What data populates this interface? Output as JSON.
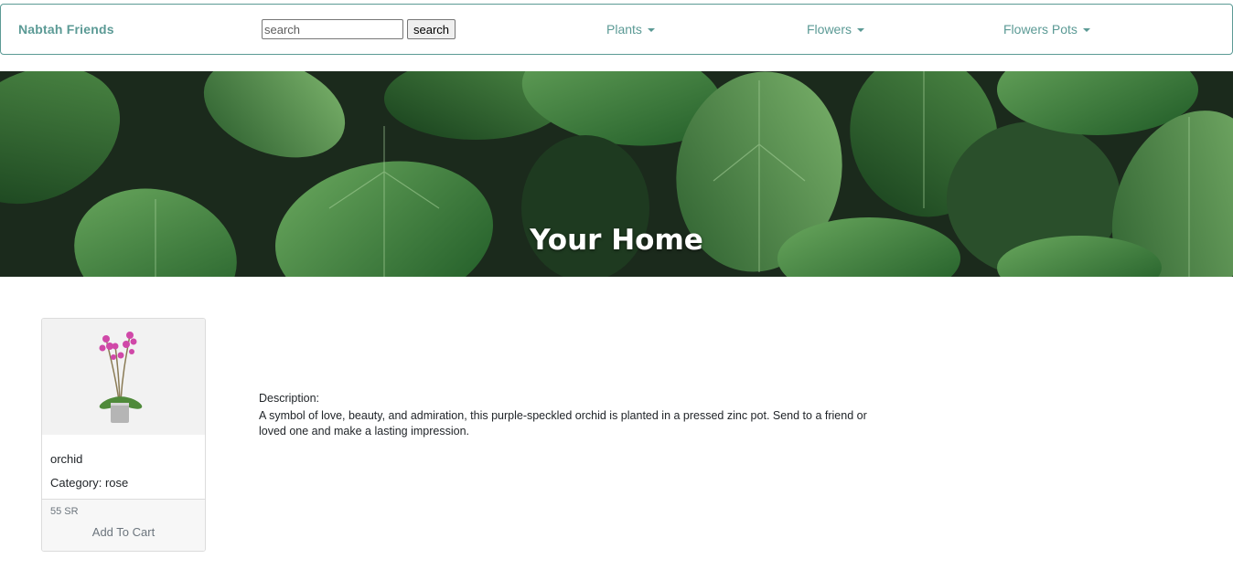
{
  "navbar": {
    "brand": "Nabtah Friends",
    "search": {
      "placeholder": "search",
      "value": "",
      "button_label": "search"
    },
    "menus": [
      {
        "label": "Plants"
      },
      {
        "label": "Flowers"
      },
      {
        "label": "Flowers Pots"
      }
    ]
  },
  "hero": {
    "title": "Your Home"
  },
  "product": {
    "name": "orchid",
    "category": "Category: rose",
    "price": "55 SR",
    "cart_label": "Add To Cart"
  },
  "description": {
    "label": "Description:",
    "text": "A symbol of love, beauty, and admiration, this purple-speckled orchid is planted in a pressed zinc pot. Send to a friend or loved one and make a lasting impression."
  },
  "colors": {
    "accent": "#5b9a95",
    "leaf_dark": "#1c2a1e",
    "leaf_green": "#3d7a3a",
    "orchid_pink": "#d048a8"
  }
}
